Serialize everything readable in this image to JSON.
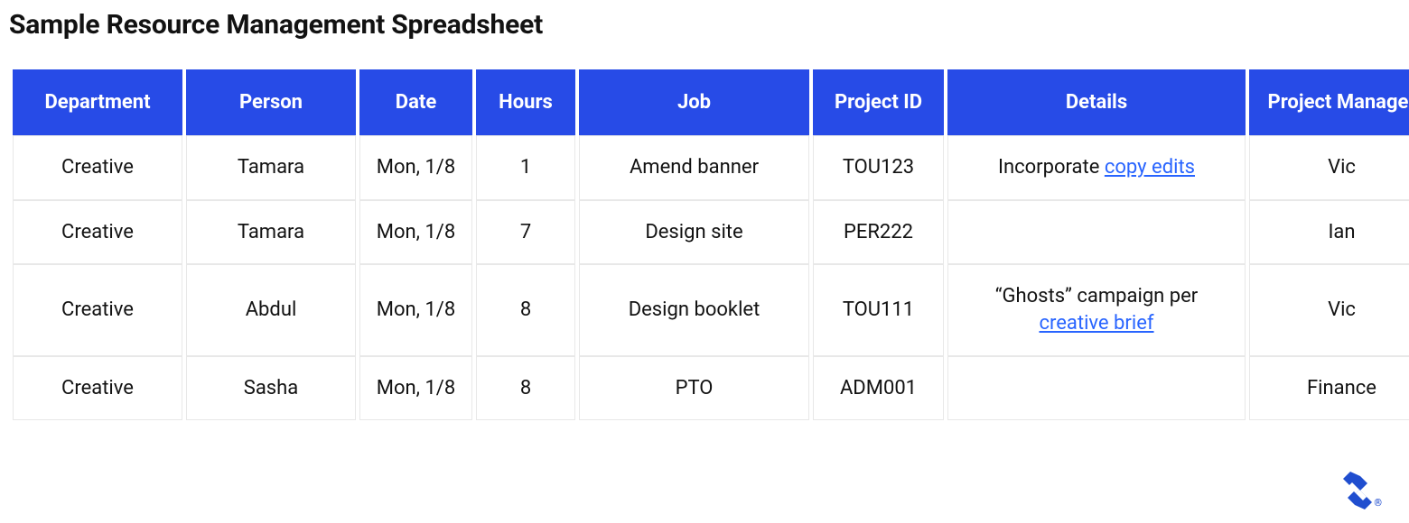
{
  "title": "Sample Resource Management Spreadsheet",
  "colors": {
    "header_bg": "#274be7",
    "link": "#2864ff"
  },
  "columns": [
    "Department",
    "Person",
    "Date",
    "Hours",
    "Job",
    "Project ID",
    "Details",
    "Project Manager"
  ],
  "rows": [
    {
      "department": "Creative",
      "person": "Tamara",
      "date": "Mon, 1/8",
      "hours": "1",
      "job": "Amend banner",
      "project_id": "TOU123",
      "details_prefix": "Incorporate ",
      "details_link": "copy edits",
      "details_suffix": "",
      "project_manager": "Vic"
    },
    {
      "department": "Creative",
      "person": "Tamara",
      "date": "Mon, 1/8",
      "hours": "7",
      "job": "Design site",
      "project_id": "PER222",
      "details_prefix": "",
      "details_link": "",
      "details_suffix": "",
      "project_manager": "Ian"
    },
    {
      "department": "Creative",
      "person": "Abdul",
      "date": "Mon, 1/8",
      "hours": "8",
      "job": "Design booklet",
      "project_id": "TOU111",
      "details_prefix": "“Ghosts” campaign per ",
      "details_link": "creative brief",
      "details_suffix": "",
      "project_manager": "Vic"
    },
    {
      "department": "Creative",
      "person": "Sasha",
      "date": "Mon, 1/8",
      "hours": "8",
      "job": "PTO",
      "project_id": "ADM001",
      "details_prefix": "",
      "details_link": "",
      "details_suffix": "",
      "project_manager": "Finance"
    }
  ],
  "footer": {
    "registered_mark": "®"
  }
}
